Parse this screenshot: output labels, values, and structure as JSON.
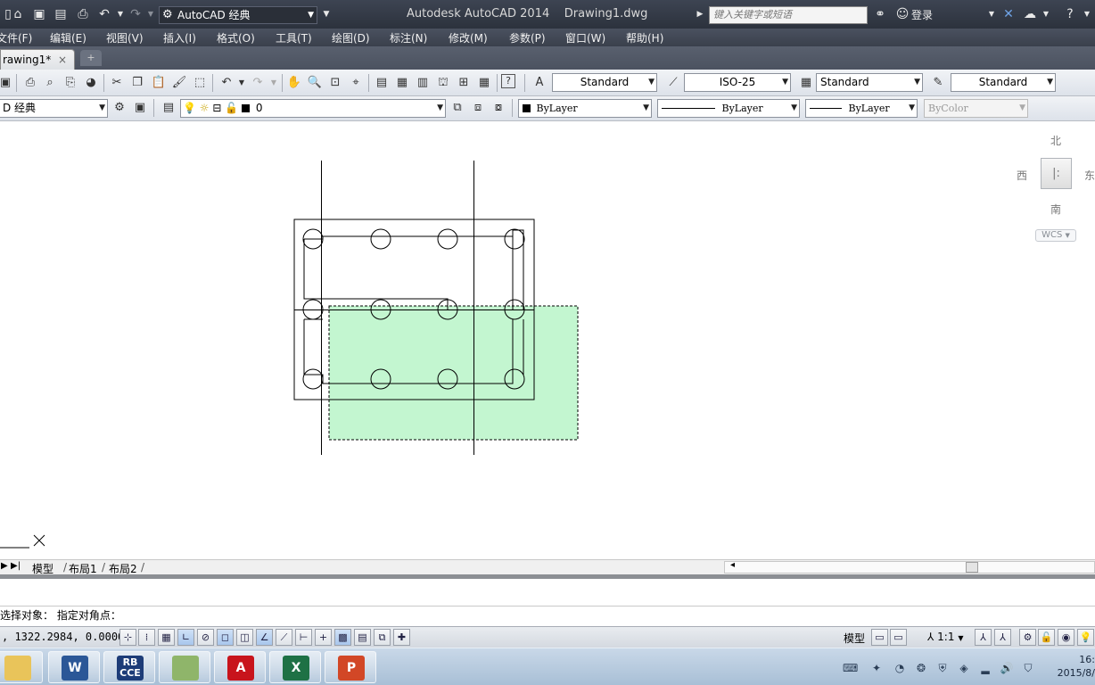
{
  "titlebar": {
    "workspace": "AutoCAD 经典",
    "title": "Autodesk AutoCAD 2014    Drawing1.dwg",
    "search_placeholder": "键入关键字或短语",
    "login": "登录"
  },
  "menu": [
    "文件(F)",
    "编辑(E)",
    "视图(V)",
    "插入(I)",
    "格式(O)",
    "工具(T)",
    "绘图(D)",
    "标注(N)",
    "修改(M)",
    "参数(P)",
    "窗口(W)",
    "帮助(H)"
  ],
  "doc_tab": {
    "label": "rawing1*",
    "close": "×"
  },
  "styles_toolbar": {
    "text_style": "Standard",
    "dim_style": "ISO-25",
    "table_style": "Standard",
    "multileader_style": "Standard"
  },
  "layers_toolbar": {
    "workspace": "D 经典",
    "layer": "0",
    "color": "ByLayer",
    "linetype": "ByLayer",
    "lineweight": "ByLayer",
    "plotstyle": "ByColor"
  },
  "viewcube": {
    "north": "北",
    "west": "西",
    "east": "东",
    "south": "南",
    "wcs": "WCS"
  },
  "layout_tabs": [
    "模型",
    "布局1",
    "布局2"
  ],
  "command": {
    "prompt": "选择对象：  指定对角点："
  },
  "status": {
    "coords": ", 1322.2984, 0.0000",
    "model": "模型",
    "scale": "1:1"
  },
  "taskbar": {
    "clock_time": "16:",
    "clock_date": "2015/8/"
  },
  "colors": {
    "selection_fill": "#b8f5c8",
    "title_bg": "#333a46",
    "toolbar_bg": "#e6e9ee"
  }
}
